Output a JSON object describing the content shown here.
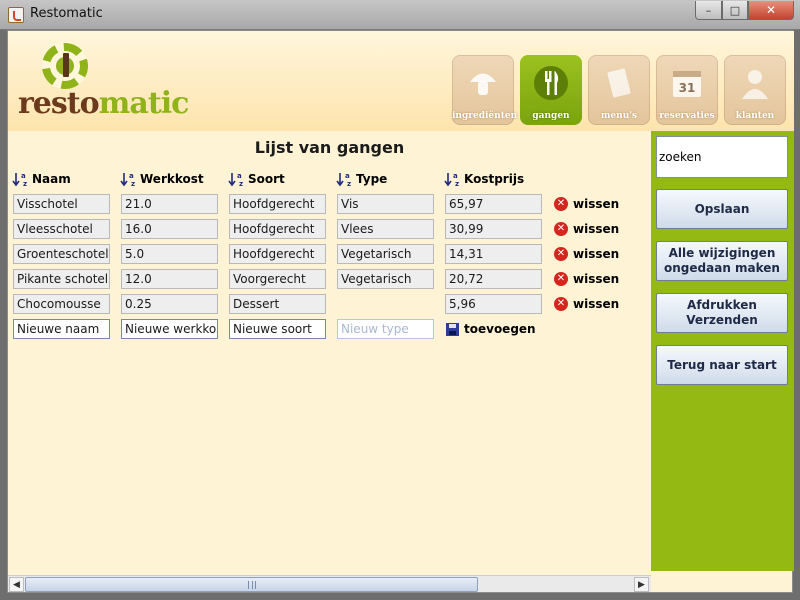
{
  "window": {
    "title": "Restomatic",
    "controls": {
      "minimize": "–",
      "maximize": "□",
      "close": "✕"
    }
  },
  "logo": {
    "part1": "resto",
    "part2": "matic"
  },
  "nav": [
    {
      "label": "ingrediënten",
      "icon": "mushroom-icon",
      "active": false
    },
    {
      "label": "gangen",
      "icon": "fork-icon",
      "active": true
    },
    {
      "label": "menu's",
      "icon": "menu-book-icon",
      "active": false
    },
    {
      "label": "reservaties",
      "icon": "calendar-icon",
      "active": false
    },
    {
      "label": "klanten",
      "icon": "person-icon",
      "active": false
    }
  ],
  "calendar_day": "31",
  "page_title": "Lijst van gangen",
  "columns": [
    {
      "label": "Naam"
    },
    {
      "label": "Werkkost"
    },
    {
      "label": "Soort"
    },
    {
      "label": "Type"
    },
    {
      "label": "Kostprijs"
    }
  ],
  "rows": [
    {
      "naam": "Visschotel",
      "werkkost": "21.0",
      "soort": "Hoofdgerecht",
      "type": "Vis",
      "kostprijs": "65,97"
    },
    {
      "naam": "Vleesschotel",
      "werkkost": "16.0",
      "soort": "Hoofdgerecht",
      "type": "Vlees",
      "kostprijs": "30,99"
    },
    {
      "naam": "Groenteschotel",
      "werkkost": "5.0",
      "soort": "Hoofdgerecht",
      "type": "Vegetarisch",
      "kostprijs": "14,31"
    },
    {
      "naam": "Pikante schotel",
      "werkkost": "12.0",
      "soort": "Voorgerecht",
      "type": "Vegetarisch",
      "kostprijs": "20,72"
    },
    {
      "naam": "Chocomousse",
      "werkkost": "0.25",
      "soort": "Dessert",
      "type": "",
      "kostprijs": "5,96"
    }
  ],
  "delete_label": "wissen",
  "new_row": {
    "naam": "Nieuwe naam",
    "werkkost": "Nieuwe werkkost",
    "soort": "Nieuwe soort",
    "type_placeholder": "Nieuw type",
    "add_label": "toevoegen"
  },
  "sidebar": {
    "search_value": "zoeken",
    "save": "Opslaan",
    "undo": "Alle wijzigingen\nongedaan maken",
    "print": "Afdrukken\nVerzenden",
    "back": "Terug naar start"
  },
  "colors": {
    "accent_green": "#95b913",
    "brown": "#6b3a1d",
    "background": "#fff3d6",
    "delete_red": "#d4261f"
  }
}
